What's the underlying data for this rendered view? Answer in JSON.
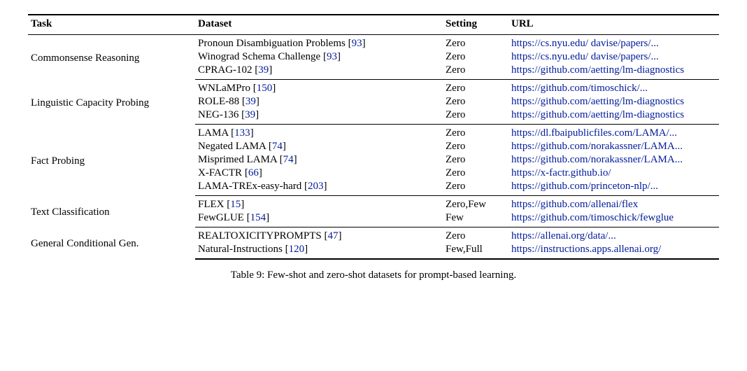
{
  "headers": {
    "task": "Task",
    "dataset": "Dataset",
    "setting": "Setting",
    "url": "URL"
  },
  "groups": [
    {
      "task": "Commonsense Reasoning",
      "rows": [
        {
          "dataset": "Pronoun Disambiguation Problems",
          "ref": "93",
          "setting": "Zero",
          "url": "https://cs.nyu.edu/ davise/papers/..."
        },
        {
          "dataset": "Winograd Schema Challenge",
          "ref": "93",
          "setting": "Zero",
          "url": "https://cs.nyu.edu/ davise/papers/..."
        },
        {
          "dataset": "CPRAG-102",
          "ref": "39",
          "setting": "Zero",
          "url": "https://github.com/aetting/lm-diagnostics"
        }
      ]
    },
    {
      "task": "Linguistic Capacity Probing",
      "rows": [
        {
          "dataset": "WNLaMPro",
          "ref": "150",
          "setting": "Zero",
          "url": "https://github.com/timoschick/..."
        },
        {
          "dataset": "ROLE-88",
          "ref": "39",
          "setting": "Zero",
          "url": "https://github.com/aetting/lm-diagnostics"
        },
        {
          "dataset": "NEG-136",
          "ref": "39",
          "setting": "Zero",
          "url": "https://github.com/aetting/lm-diagnostics"
        }
      ]
    },
    {
      "task": "Fact Probing",
      "rows": [
        {
          "dataset": "LAMA",
          "ref": "133",
          "setting": "Zero",
          "url": "https://dl.fbaipublicfiles.com/LAMA/..."
        },
        {
          "dataset": "Negated LAMA",
          "ref": "74",
          "setting": "Zero",
          "url": "https://github.com/norakassner/LAMA..."
        },
        {
          "dataset": "Misprimed LAMA",
          "ref": "74",
          "setting": "Zero",
          "url": "https://github.com/norakassner/LAMA..."
        },
        {
          "dataset": "X-FACTR",
          "ref": "66",
          "setting": "Zero",
          "url": "https://x-factr.github.io/"
        },
        {
          "dataset": "LAMA-TREx-easy-hard",
          "ref": "203",
          "setting": "Zero",
          "url": "https://github.com/princeton-nlp/..."
        }
      ]
    },
    {
      "task": "Text Classification",
      "rows": [
        {
          "dataset": "FLEX",
          "ref": "15",
          "setting": "Zero,Few",
          "url": "https://github.com/allenai/flex"
        },
        {
          "dataset": "FewGLUE",
          "ref": "154",
          "setting": "Few",
          "url": "https://github.com/timoschick/fewglue"
        }
      ]
    },
    {
      "task": "General Conditional Gen.",
      "rows": [
        {
          "dataset": "REALTOXICITYPROMPTS",
          "ref": "47",
          "setting": "Zero",
          "url": "https://allenai.org/data/..."
        },
        {
          "dataset": "Natural-Instructions",
          "ref": "120",
          "setting": "Few,Full",
          "url": "https://instructions.apps.allenai.org/"
        }
      ]
    }
  ],
  "caption": "Table 9: Few-shot and zero-shot datasets for prompt-based learning."
}
